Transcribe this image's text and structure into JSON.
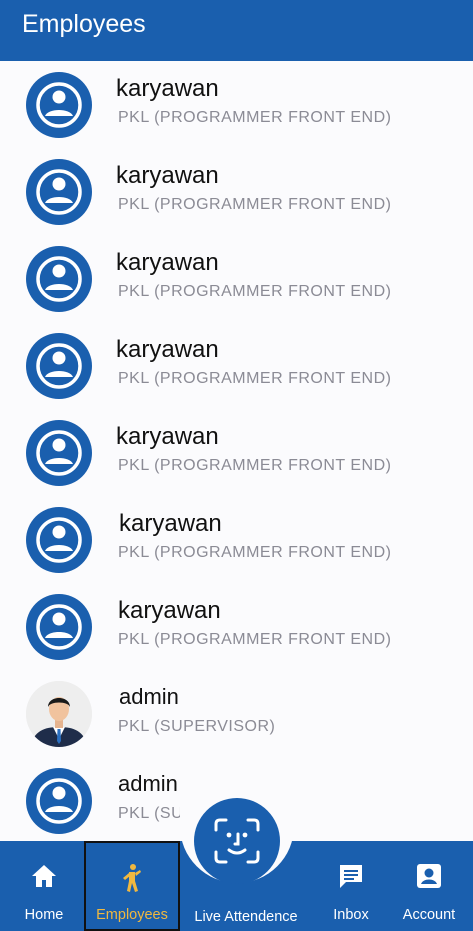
{
  "header": {
    "title": "Employees"
  },
  "employees": [
    {
      "name": "karyawan",
      "role": "PKL (PROGRAMMER FRONT END)",
      "avatar": "default-person-icon"
    },
    {
      "name": "karyawan",
      "role": "PKL (PROGRAMMER FRONT END)",
      "avatar": "default-person-icon"
    },
    {
      "name": "karyawan",
      "role": "PKL (PROGRAMMER FRONT END)",
      "avatar": "default-person-icon"
    },
    {
      "name": "karyawan",
      "role": "PKL (PROGRAMMER FRONT END)",
      "avatar": "default-person-icon"
    },
    {
      "name": "karyawan",
      "role": "PKL (PROGRAMMER FRONT END)",
      "avatar": "default-person-icon"
    },
    {
      "name": "karyawan",
      "role": "PKL (PROGRAMMER FRONT END)",
      "avatar": "default-person-icon"
    },
    {
      "name": "karyawan",
      "role": "PKL (PROGRAMMER FRONT END)",
      "avatar": "default-person-icon"
    },
    {
      "name": "admin",
      "role": "PKL (SUPERVISOR)",
      "avatar": "businessman-photo"
    },
    {
      "name": "admin",
      "role": "PKL (SUPER",
      "avatar": "default-person-icon"
    }
  ],
  "nav": {
    "home": "Home",
    "employees": "Employees",
    "live_attendance": "Live Attendence",
    "inbox": "Inbox",
    "account": "Account"
  },
  "colors": {
    "primary": "#1a5fae",
    "active": "#f0b840",
    "background": "#fbfbfd"
  }
}
